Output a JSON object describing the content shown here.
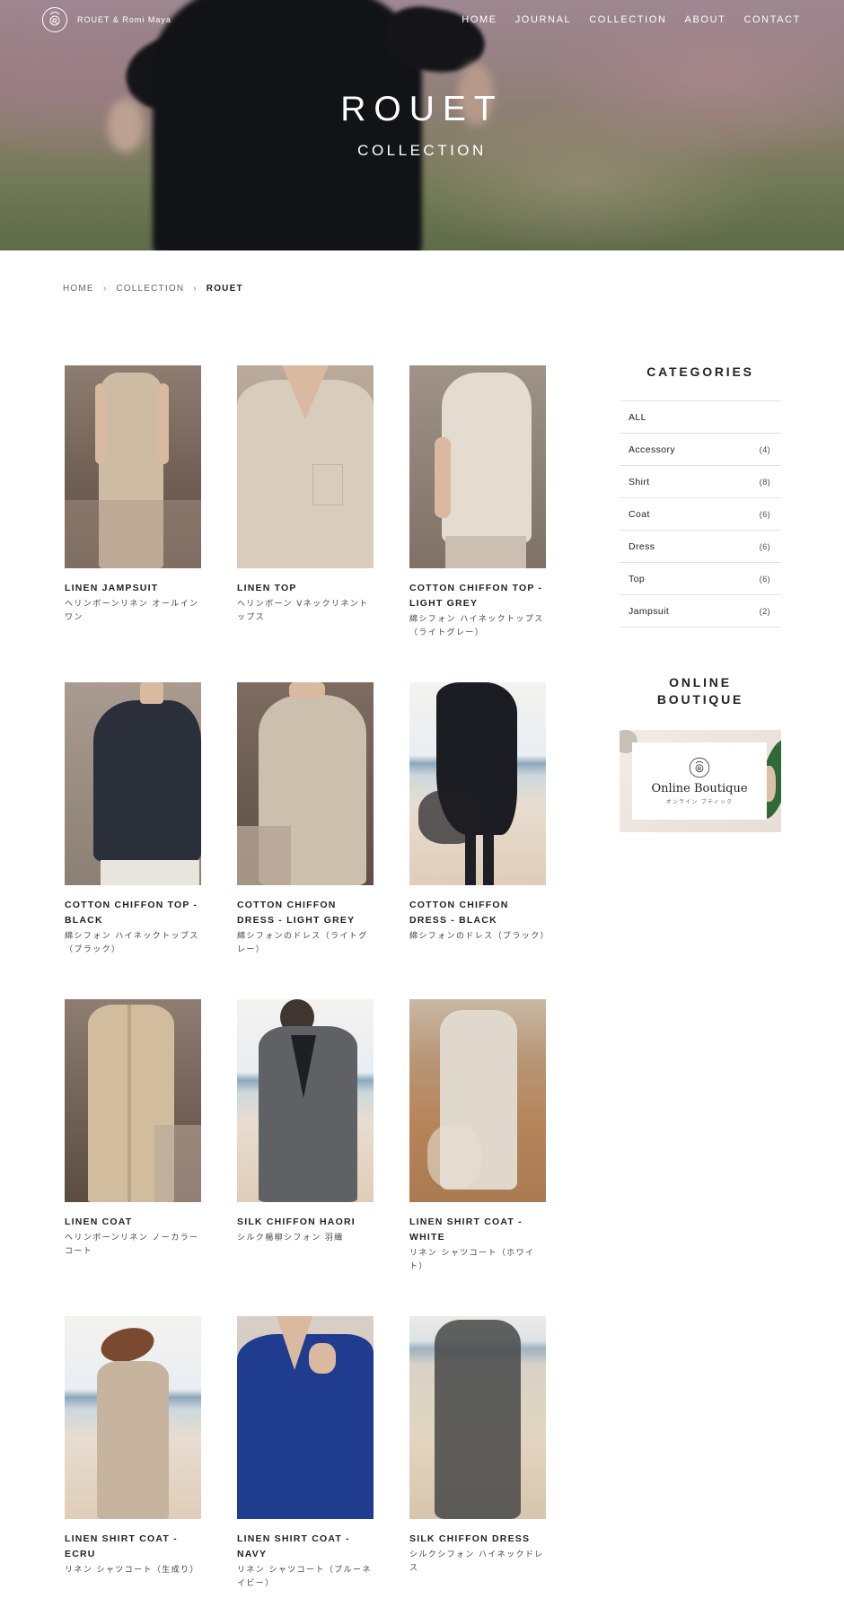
{
  "brand": {
    "name": "ROUET & Romi Maya"
  },
  "nav": [
    "HOME",
    "JOURNAL",
    "COLLECTION",
    "ABOUT",
    "CONTACT"
  ],
  "hero": {
    "title": "ROUET",
    "subtitle": "COLLECTION"
  },
  "breadcrumb": {
    "items": [
      "HOME",
      "COLLECTION"
    ],
    "current": "ROUET"
  },
  "products": [
    {
      "name": "LINEN JAMPSUIT",
      "jp": "ヘリンボーンリネン オールインワン"
    },
    {
      "name": "LINEN TOP",
      "jp": "ヘリンボーン Vネックリネントップス"
    },
    {
      "name": "COTTON CHIFFON TOP - LIGHT GREY",
      "jp": "綿シフォン ハイネックトップス（ライトグレー）"
    },
    {
      "name": "COTTON CHIFFON TOP - BLACK",
      "jp": "綿シフォン ハイネックトップス（ブラック）"
    },
    {
      "name": "COTTON CHIFFON DRESS - LIGHT GREY",
      "jp": "綿シフォンのドレス（ライトグレー）"
    },
    {
      "name": "COTTON CHIFFON DRESS - BLACK",
      "jp": "綿シフォンのドレス（ブラック）"
    },
    {
      "name": "LINEN COAT",
      "jp": "ヘリンボーンリネン ノーカラーコート"
    },
    {
      "name": "SILK CHIFFON HAORI",
      "jp": "シルク楊柳シフォン 羽織"
    },
    {
      "name": "LINEN SHIRT COAT - WHITE",
      "jp": "リネン シャツコート（ホワイト）"
    },
    {
      "name": "LINEN SHIRT COAT - ECRU",
      "jp": "リネン シャツコート（生成り）"
    },
    {
      "name": "LINEN SHIRT COAT - NAVY",
      "jp": "リネン シャツコート（ブルーネイビー）"
    },
    {
      "name": "SILK CHIFFON DRESS",
      "jp": "シルクシフォン ハイネックドレス"
    }
  ],
  "sidebar": {
    "categories_title": "CATEGORIES",
    "categories": [
      {
        "label": "ALL",
        "count": ""
      },
      {
        "label": "Accessory",
        "count": "(4)"
      },
      {
        "label": "Shirt",
        "count": "(8)"
      },
      {
        "label": "Coat",
        "count": "(6)"
      },
      {
        "label": "Dress",
        "count": "(6)"
      },
      {
        "label": "Top",
        "count": "(6)"
      },
      {
        "label": "Jampsuit",
        "count": "(2)"
      }
    ],
    "boutique_title_line1": "ONLINE",
    "boutique_title_line2": "BOUTIQUE",
    "boutique_banner_main": "Online Boutique",
    "boutique_banner_sub": "オンライン ブティック"
  }
}
